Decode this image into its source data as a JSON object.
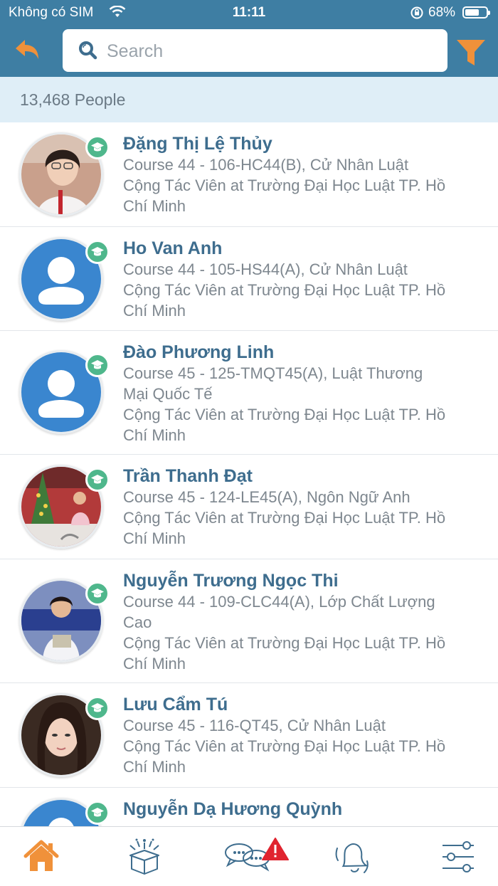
{
  "status_bar": {
    "carrier": "Không có SIM",
    "time": "11:11",
    "battery": "68%",
    "battery_level": 0.68
  },
  "header": {
    "search_placeholder": "Search"
  },
  "count_label": "13,468 People",
  "people": [
    {
      "name": "Đặng Thị Lệ Thủy",
      "course_lines": [
        "Course 44 - 106-HC44(B), Cử Nhân Luật"
      ],
      "role_lines": [
        "Cộng Tác Viên at Trường Đại Học Luật TP. Hồ",
        "Chí Minh"
      ],
      "photo": "photo"
    },
    {
      "name": "Ho Van Anh",
      "course_lines": [
        "Course 44 - 105-HS44(A), Cử Nhân Luật"
      ],
      "role_lines": [
        "Cộng Tác Viên at Trường Đại Học Luật TP. Hồ",
        "Chí Minh"
      ],
      "photo": "default"
    },
    {
      "name": "Đào Phương Linh",
      "course_lines": [
        "Course 45 - 125-TMQT45(A), Luật Thương",
        "Mại Quốc Tế"
      ],
      "role_lines": [
        "Cộng Tác Viên at Trường Đại Học Luật TP. Hồ",
        "Chí Minh"
      ],
      "photo": "default"
    },
    {
      "name": "Trần Thanh Đạt",
      "course_lines": [
        "Course 45 - 124-LE45(A), Ngôn Ngữ Anh"
      ],
      "role_lines": [
        "Cộng Tác Viên at Trường Đại Học Luật TP. Hồ",
        "Chí Minh"
      ],
      "photo": "photo"
    },
    {
      "name": "Nguyễn Trương Ngọc Thi",
      "course_lines": [
        "Course 44 - 109-CLC44(A), Lớp Chất Lượng",
        "Cao"
      ],
      "role_lines": [
        "Cộng Tác Viên at Trường Đại Học Luật TP. Hồ",
        "Chí Minh"
      ],
      "photo": "photo"
    },
    {
      "name": "Lưu Cẩm Tú",
      "course_lines": [
        "Course 45 - 116-QT45, Cử Nhân Luật"
      ],
      "role_lines": [
        "Cộng Tác Viên at Trường Đại Học Luật TP. Hồ",
        "Chí Minh"
      ],
      "photo": "photo"
    },
    {
      "name": "Nguyễn Dạ Hương Quỳnh",
      "course_lines": [],
      "role_lines": [],
      "photo": "default"
    }
  ],
  "tabs": [
    {
      "id": "home",
      "icon": "home-icon",
      "active": true
    },
    {
      "id": "events",
      "icon": "gift-box-icon",
      "active": false
    },
    {
      "id": "messages",
      "icon": "chat-alert-icon",
      "active": false
    },
    {
      "id": "notifications",
      "icon": "bell-icon",
      "active": false
    },
    {
      "id": "settings",
      "icon": "sliders-icon",
      "active": false
    }
  ],
  "colors": {
    "header": "#3e7ea3",
    "accent": "#f0913a",
    "name": "#3e6d8e",
    "badge": "#4fb78c",
    "count_bg": "#dfeef7"
  }
}
